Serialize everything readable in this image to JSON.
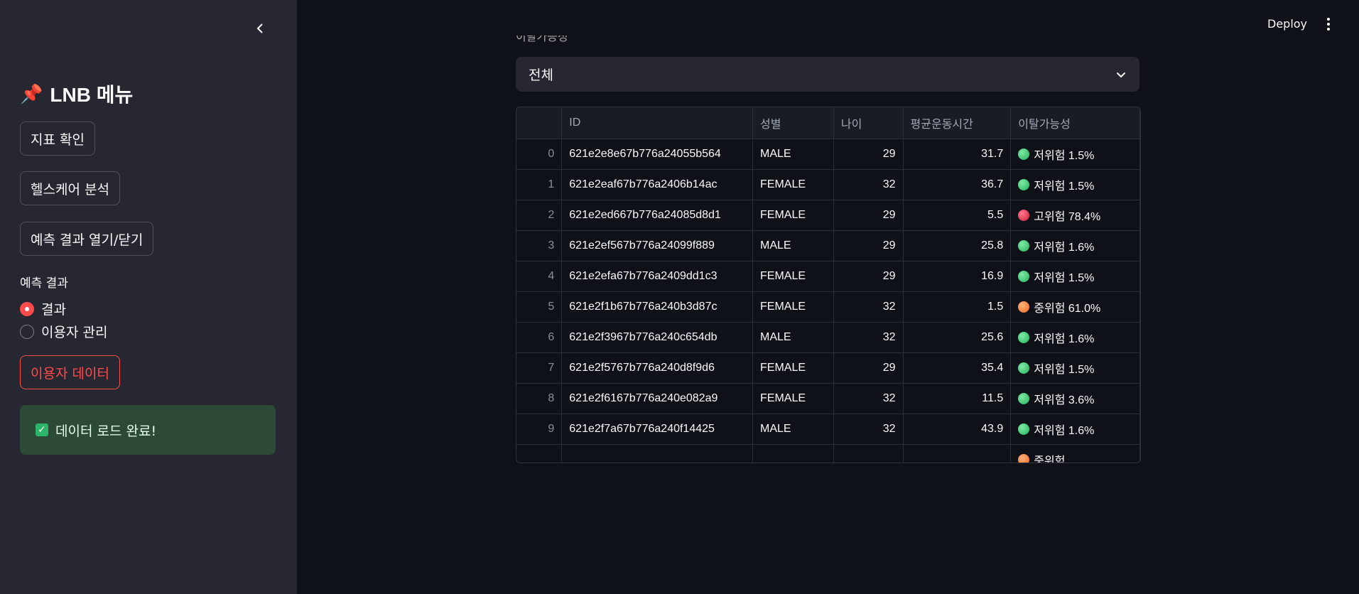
{
  "header": {
    "deploy_label": "Deploy"
  },
  "sidebar": {
    "title": "LNB 메뉴",
    "title_icon": "📌",
    "buttons": {
      "metrics": "지표 확인",
      "healthcare": "헬스케어 분석",
      "toggle_results": "예측 결과 열기/닫기",
      "user_data": "이용자 데이터"
    },
    "radio": {
      "label": "예측 결과",
      "options": [
        "결과",
        "이용자 관리"
      ],
      "selected": "결과"
    },
    "success_message": "데이터 로드 완료!",
    "colors": {
      "accent": "#ff4b4b",
      "success_bg": "#2c4a37"
    }
  },
  "main": {
    "filter_label_partial": "이탈가능성",
    "select_value": "전체",
    "table": {
      "columns": [
        "",
        "ID",
        "성별",
        "나이",
        "평균운동시간",
        "이탈가능성"
      ],
      "rows": [
        {
          "idx": "0",
          "id": "621e2e8e67b776a24055b564",
          "gender": "MALE",
          "age": "29",
          "avg": "31.7",
          "risk_icon": "green-circle",
          "risk": "저위험 1.5%"
        },
        {
          "idx": "1",
          "id": "621e2eaf67b776a2406b14ac",
          "gender": "FEMALE",
          "age": "32",
          "avg": "36.7",
          "risk_icon": "green-circle",
          "risk": "저위험 1.5%"
        },
        {
          "idx": "2",
          "id": "621e2ed667b776a24085d8d1",
          "gender": "FEMALE",
          "age": "29",
          "avg": "5.5",
          "risk_icon": "red-circle",
          "risk": "고위험 78.4%"
        },
        {
          "idx": "3",
          "id": "621e2ef567b776a24099f889",
          "gender": "MALE",
          "age": "29",
          "avg": "25.8",
          "risk_icon": "green-circle",
          "risk": "저위험 1.6%"
        },
        {
          "idx": "4",
          "id": "621e2efa67b776a2409dd1c3",
          "gender": "FEMALE",
          "age": "29",
          "avg": "16.9",
          "risk_icon": "green-circle",
          "risk": "저위험 1.5%"
        },
        {
          "idx": "5",
          "id": "621e2f1b67b776a240b3d87c",
          "gender": "FEMALE",
          "age": "32",
          "avg": "1.5",
          "risk_icon": "orange-circle",
          "risk": "중위험 61.0%"
        },
        {
          "idx": "6",
          "id": "621e2f3967b776a240c654db",
          "gender": "MALE",
          "age": "32",
          "avg": "25.6",
          "risk_icon": "green-circle",
          "risk": "저위험 1.6%"
        },
        {
          "idx": "7",
          "id": "621e2f5767b776a240d8f9d6",
          "gender": "FEMALE",
          "age": "29",
          "avg": "35.4",
          "risk_icon": "green-circle",
          "risk": "저위험 1.5%"
        },
        {
          "idx": "8",
          "id": "621e2f6167b776a240e082a9",
          "gender": "FEMALE",
          "age": "32",
          "avg": "11.5",
          "risk_icon": "green-circle",
          "risk": "저위험 3.6%"
        },
        {
          "idx": "9",
          "id": "621e2f7a67b776a240f14425",
          "gender": "MALE",
          "age": "32",
          "avg": "43.9",
          "risk_icon": "green-circle",
          "risk": "저위험 1.6%"
        },
        {
          "idx": "",
          "id": "",
          "gender": "",
          "age": "",
          "avg": "",
          "risk_icon": "orange-circle",
          "risk": "중위험"
        }
      ]
    }
  }
}
